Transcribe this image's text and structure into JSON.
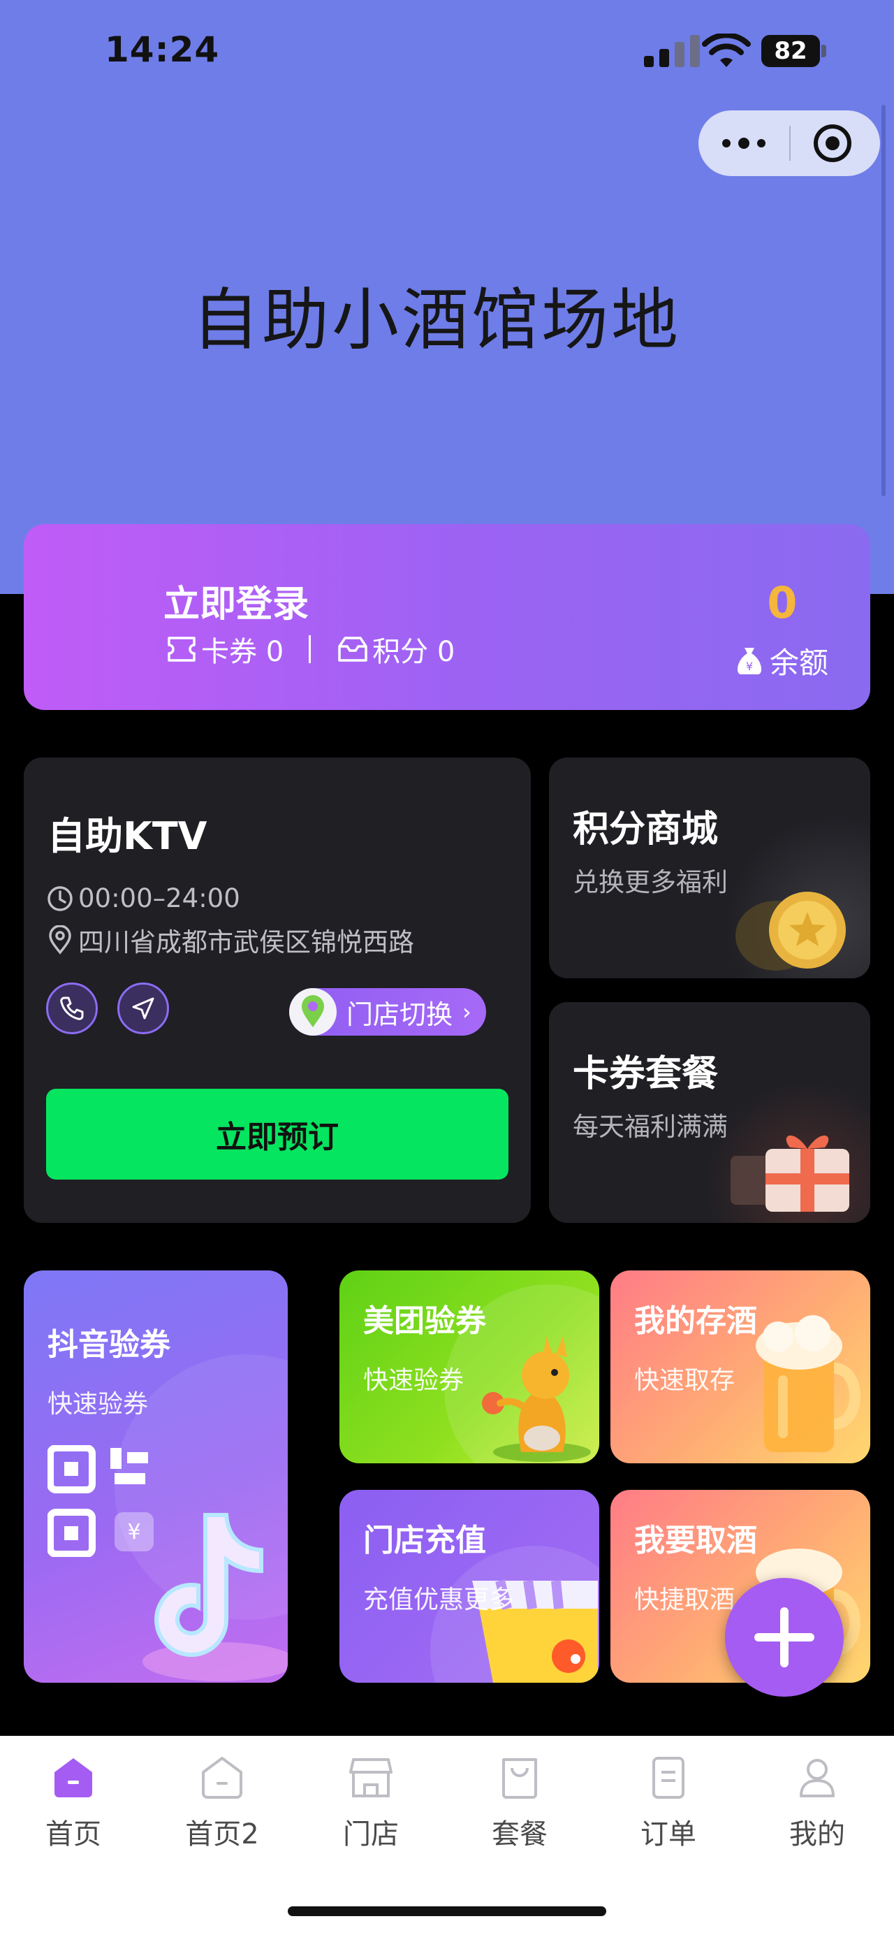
{
  "status_bar": {
    "time": "14:24",
    "battery": "82"
  },
  "banner": {
    "title": "自助小酒馆场地"
  },
  "login_card": {
    "title": "立即登录",
    "coupons_label": "卡券 0",
    "points_label": "积分 0",
    "balance_value": "0",
    "balance_label": "余额"
  },
  "store_card": {
    "name": "自助KTV",
    "hours": "00:00–24:00",
    "address": "四川省成都市武侯区锦悦西路",
    "switch_label": "门店切换",
    "book_label": "立即预订"
  },
  "promo_cards": {
    "mall": {
      "title": "积分商城",
      "subtitle": "兑换更多福利"
    },
    "coupon": {
      "title": "卡券套餐",
      "subtitle": "每天福利满满"
    }
  },
  "tiles": {
    "douyin": {
      "title": "抖音验券",
      "subtitle": "快速验券"
    },
    "meituan": {
      "title": "美团验券",
      "subtitle": "快速验券"
    },
    "cunjiu": {
      "title": "我的存酒",
      "subtitle": "快速取存"
    },
    "chongzhi": {
      "title": "门店充值",
      "subtitle": "充值优惠更多"
    },
    "qujiu": {
      "title": "我要取酒",
      "subtitle": "快捷取酒"
    }
  },
  "tabbar": [
    {
      "label": "首页",
      "icon": "home-icon",
      "active": true
    },
    {
      "label": "首页2",
      "icon": "home-outline-icon",
      "active": false
    },
    {
      "label": "门店",
      "icon": "store-icon",
      "active": false
    },
    {
      "label": "套餐",
      "icon": "bag-icon",
      "active": false
    },
    {
      "label": "订单",
      "icon": "order-icon",
      "active": false
    },
    {
      "label": "我的",
      "icon": "user-icon",
      "active": false
    }
  ],
  "colors": {
    "accent": "#9b63f3",
    "book_green": "#05e55f",
    "balance_gold": "#f4b63b",
    "banner": "#6f7de8"
  }
}
